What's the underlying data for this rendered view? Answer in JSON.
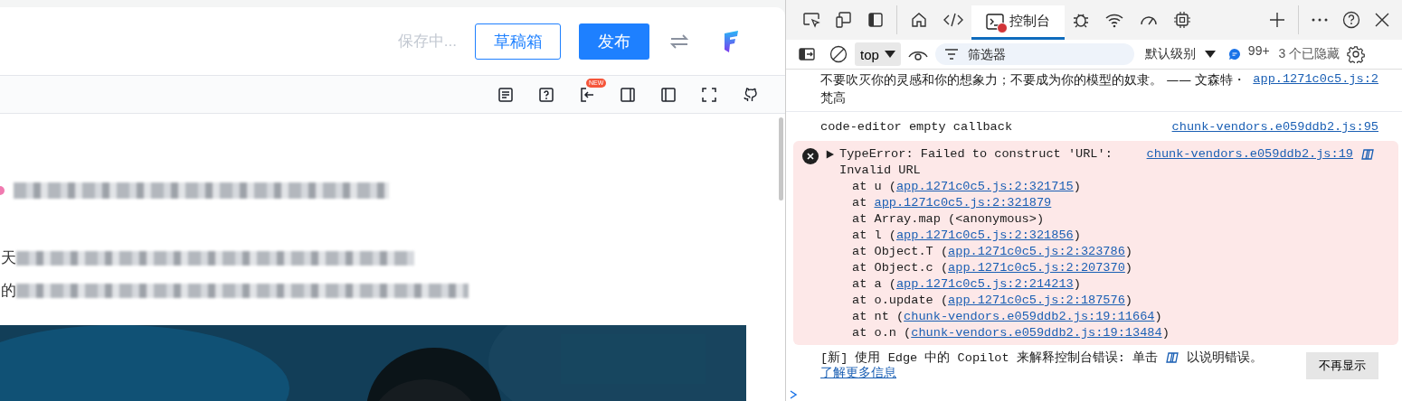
{
  "editor": {
    "save_status": "保存中...",
    "draft_button": "草稿箱",
    "publish_button": "发布",
    "toolbar": {
      "new_badge": "NEW"
    },
    "content": {
      "line_starts": [
        "天",
        "的"
      ],
      "image": {
        "kind": "picture"
      }
    }
  },
  "devtools": {
    "console_tab": {
      "label": "控制台",
      "selected": true,
      "has_error": true
    },
    "toolbar": {
      "context": "top",
      "filter_placeholder": "筛选器",
      "level": "默认级别",
      "message_count": "99+",
      "hidden": "3 个已隐藏"
    },
    "messages": [
      {
        "kind": "log",
        "text": "不要吹灭你的灵感和你的想象力；不要成为你的模型的奴隶。 —— 文森特・梵高",
        "source": "app.1271c0c5.js:2"
      },
      {
        "kind": "log",
        "text": "code-editor empty callback",
        "source": "chunk-vendors.e059ddb2.js:95"
      },
      {
        "kind": "error",
        "text": "TypeError: Failed to construct 'URL': Invalid URL",
        "source": "chunk-vendors.e059ddb2.js:19",
        "expanded": false,
        "frames": [
          {
            "pre": "at u (",
            "link": "app.1271c0c5.js:2:321715",
            "post": ")"
          },
          {
            "pre": "at ",
            "link": "app.1271c0c5.js:2:321879"
          },
          {
            "pre": "at Array.map (<anonymous>)"
          },
          {
            "pre": "at l (",
            "link": "app.1271c0c5.js:2:321856",
            "post": ")"
          },
          {
            "pre": "at Object.T (",
            "link": "app.1271c0c5.js:2:323786",
            "post": ")"
          },
          {
            "pre": "at Object.c (",
            "link": "app.1271c0c5.js:2:207370",
            "post": ")"
          },
          {
            "pre": "at a (",
            "link": "app.1271c0c5.js:2:214213",
            "post": ")"
          },
          {
            "pre": "at o.update (",
            "link": "app.1271c0c5.js:2:187576",
            "post": ")"
          },
          {
            "pre": "at nt (",
            "link": "chunk-vendors.e059ddb2.js:19:11664",
            "post": ")"
          },
          {
            "pre": "at o.n (",
            "link": "chunk-vendors.e059ddb2.js:19:13484",
            "post": ")"
          }
        ]
      }
    ],
    "copilot_hint": {
      "before": "[新] 使用 Edge 中的 Copilot 来解释控制台错误: 单击",
      "after": "以说明错误。",
      "link": "了解更多信息",
      "dismiss_button": "不再显示"
    }
  }
}
